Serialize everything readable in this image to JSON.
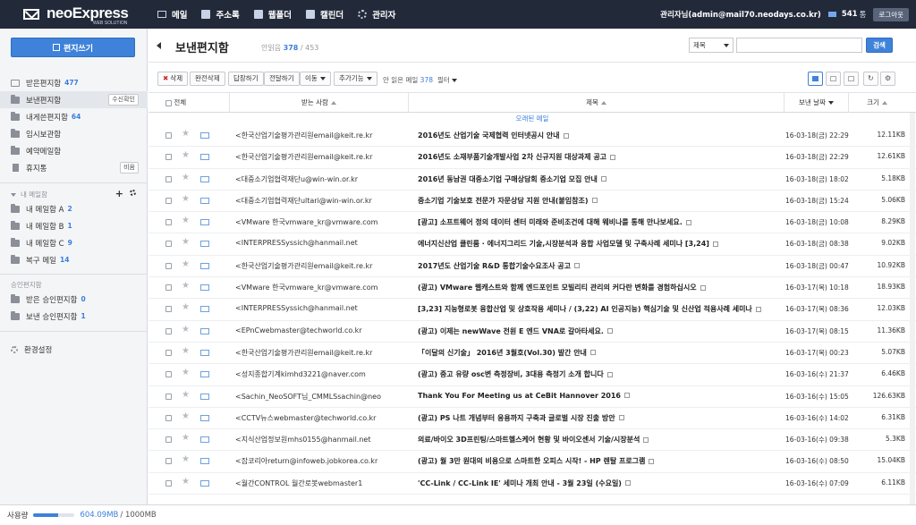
{
  "topbar": {
    "logo": {
      "name": "neoExpress",
      "sub": "WEB SOLUTION"
    },
    "nav": [
      {
        "label": "메일",
        "icon": "mail-icon"
      },
      {
        "label": "주소록",
        "icon": "addressbook-icon"
      },
      {
        "label": "웹폴더",
        "icon": "webfolder-icon"
      },
      {
        "label": "캘린더",
        "icon": "calendar-icon"
      },
      {
        "label": "관리자",
        "icon": "settings-icon"
      }
    ],
    "user": "관리자님(admin@mail70.neodays.co.kr)",
    "mail_count": "541",
    "mail_count_unit": "통",
    "logout": "로그아웃"
  },
  "sidebar": {
    "write_button": "편지쓰기",
    "folders": [
      {
        "label": "받은편지함",
        "count": "477",
        "icon": "inbox-icon"
      },
      {
        "label": "보낸편지함",
        "count": "",
        "icon": "folder-open-icon",
        "button": "수신확인",
        "selected": true
      },
      {
        "label": "내게쓴편지함",
        "count": "64",
        "icon": "folder-icon"
      },
      {
        "label": "임시보관함",
        "count": "",
        "icon": "folder-icon"
      },
      {
        "label": "예약메일함",
        "count": "",
        "icon": "folder-icon"
      },
      {
        "label": "휴지통",
        "count": "",
        "icon": "trash-icon",
        "button": "비움"
      }
    ],
    "my_mailbox_header": "내 메일함",
    "my_folders": [
      {
        "label": "내 메일함 A",
        "count": "2"
      },
      {
        "label": "내 메일함 B",
        "count": "1"
      },
      {
        "label": "내 메일함 C",
        "count": "9"
      },
      {
        "label": "복구 메일",
        "count": "14"
      }
    ],
    "approval_header": "승인편지함",
    "approval_folders": [
      {
        "label": "받은 승인편지함",
        "count": "0"
      },
      {
        "label": "보낸 승인편지함",
        "count": "1"
      }
    ],
    "settings": "환경설정"
  },
  "footer": {
    "label": "사용량",
    "used": "604.09MB",
    "total": "/ 1000MB",
    "usage_fraction": 0.604
  },
  "main": {
    "title": "보낸편지함",
    "counts_label": "안읽음",
    "unread": "378",
    "total": "/ 453",
    "search": {
      "select": "제목",
      "placeholder": "",
      "button": "검색"
    },
    "toolbar": {
      "delete": "삭제",
      "delete_perm": "완전삭제",
      "reply": "답장하기",
      "forward": "전달하기",
      "move": "이동",
      "more": "추가기능",
      "unread_label": "안 읽은 메일",
      "unread_count": "378",
      "filter": "필터"
    },
    "columns": {
      "all": "전체",
      "recipient": "받는 사람",
      "subject": "제목",
      "date": "보낸 날짜",
      "size": "크기"
    },
    "group_label": "오래된 메일",
    "rows": [
      {
        "to": "<한국산업기술평가관리원email@keit.re.kr",
        "subject": "2016년도 산업기술 국제협력 인터넷공시 안내",
        "date": "16-03-18(금) 22:29",
        "size": "12.11KB"
      },
      {
        "to": "<한국산업기술평가관리원email@keit.re.kr",
        "subject": "2016년도 소재부품기술개발사업 2차 신규지원 대상과제 공고",
        "date": "16-03-18(금) 22:29",
        "size": "12.61KB"
      },
      {
        "to": "<대중소기업협력재단u@win-win.or.kr",
        "subject": "2016년 동남권 대중소기업 구매상담회 중소기업 모집 안내",
        "date": "16-03-18(금) 18:02",
        "size": "5.18KB"
      },
      {
        "to": "<대중소기업협력재단ultari@win-win.or.kr",
        "subject": "중소기업 기술보호 전문가 자문상담 지원 안내(붙임참조)",
        "date": "16-03-18(금) 15:24",
        "size": "5.06KB"
      },
      {
        "to": "<VMware 한국vmware_kr@vmware.com",
        "subject": "[광고] 소프트웨어 정의 데이터 센터 미래와 준비조건에 대해 웨비나를 통해 만나보세요.",
        "date": "16-03-18(금) 10:08",
        "size": "8.29KB"
      },
      {
        "to": "<INTERPRESSyssich@hanmail.net",
        "subject": "에너지신산업 클린룸 · 에너지그리드 기술,시장분석과 융합 사업모델 및 구축사례 세미나 [3,24]",
        "date": "16-03-18(금) 08:38",
        "size": "9.02KB"
      },
      {
        "to": "<한국산업기술평가관리원email@keit.re.kr",
        "subject": "2017년도 산업기술 R&D 통합기술수요조사 공고",
        "date": "16-03-18(금) 00:47",
        "size": "10.92KB"
      },
      {
        "to": "<VMware 한국vmware_kr@vmware.com",
        "subject": "(광고) VMware 웹캐스트와 함께 엔드포인트 모빌리티 관리의 커다란 변화를 경험하십시오",
        "date": "16-03-17(목) 10:18",
        "size": "18.93KB"
      },
      {
        "to": "<INTERPRESSyssich@hanmail.net",
        "subject": "[3,23] 지능형로봇 융합산업 및 상호작용 세미나 / (3,22) AI 인공지능) 핵심기술 및 신산업 적용사례 세미나",
        "date": "16-03-17(목) 08:36",
        "size": "12.03KB"
      },
      {
        "to": "<EPnCwebmaster@techworld.co.kr",
        "subject": "(광고) 이제는 newWave 전원 E 엔드 VNA로 갈아타세요.",
        "date": "16-03-17(목) 08:15",
        "size": "11.36KB"
      },
      {
        "to": "<한국산업기술평가관리원email@keit.re.kr",
        "subject": "「이달의 신기술」 2016년 3월호(Vol.30) 발간 안내",
        "date": "16-03-17(목) 00:23",
        "size": "5.07KB"
      },
      {
        "to": "<성지종합기계kimhd3221@naver.com",
        "subject": "(광고) 중고 유량 osc변 측정장비, 3대용 측정기 소개 합니다",
        "date": "16-03-16(수) 21:37",
        "size": "6.46KB"
      },
      {
        "to": "<Sachin_NeoSOFT님_CMMLSsachin@neo",
        "subject": "Thank You For Meeting us at CeBit Hannover 2016",
        "date": "16-03-16(수) 15:05",
        "size": "126.63KB"
      },
      {
        "to": "<CCTV뉴스webmaster@techworld.co.kr",
        "subject": "(광고) PS 나트 개념부터 응용까지 구축과 글로벌 시장 진출 방안",
        "date": "16-03-16(수) 14:02",
        "size": "6.31KB"
      },
      {
        "to": "<지식산업정보원mhs0155@hanmail.net",
        "subject": "의료/바이오 3D프린팅/스마트헬스케어 현황 및 바이오센서 기술/시장분석",
        "date": "16-03-16(수) 09:38",
        "size": "5.3KB"
      },
      {
        "to": "<잡코리아return@infoweb.jobkorea.co.kr",
        "subject": "(광고) 월 3만 원대의 비용으로 스마트한 오피스 시작! - HP 렌탈 프로그램",
        "date": "16-03-16(수) 08:50",
        "size": "15.04KB"
      },
      {
        "to": "<월간CONTROL 월간로봇webmaster1",
        "subject": "'CC-Link / CC-Link IE' 세미나 개최 안내 - 3월 23일 (수요일)",
        "date": "16-03-16(수) 07:09",
        "size": "6.11KB"
      }
    ]
  }
}
